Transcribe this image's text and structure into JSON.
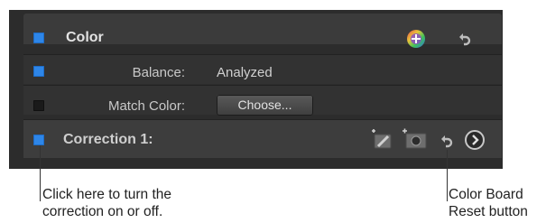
{
  "panel": {
    "header": {
      "title": "Color",
      "checkbox_on": true,
      "add_icon": "color-palette-plus-icon",
      "reset_icon": "reset-arrow-icon"
    },
    "balance": {
      "label": "Balance:",
      "value": "Analyzed",
      "checkbox_on": true
    },
    "match_color": {
      "label": "Match Color:",
      "button_label": "Choose...",
      "checkbox_on": false
    },
    "correction": {
      "label": "Correction 1:",
      "checkbox_on": true,
      "icons": [
        "mask-brush-icon",
        "shape-mask-icon",
        "reset-arrow-icon",
        "chevron-right-circle-icon"
      ]
    }
  },
  "callouts": {
    "left": {
      "line1": "Click here to turn the",
      "line2": "correction on or off."
    },
    "right": {
      "line1": "Color Board",
      "line2": "Reset button"
    }
  },
  "colors": {
    "accent_blue": "#2e86e8",
    "panel_bg": "#2c2c2c",
    "header_bg": "#3b3b3b"
  }
}
